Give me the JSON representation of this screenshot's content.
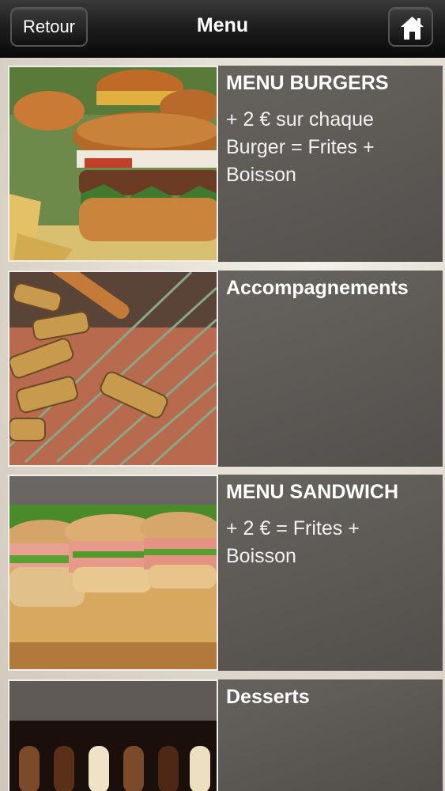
{
  "header": {
    "back_label": "Retour",
    "title": "Menu"
  },
  "items": [
    {
      "title": "MENU BURGERS",
      "description": "+ 2 € sur chaque Burger = Frites + Boisson",
      "image": "burger-photo"
    },
    {
      "title": "Accompagnements",
      "description": "",
      "image": "fries-photo"
    },
    {
      "title": "MENU SANDWICH",
      "description": "+ 2 € = Frites + Boisson",
      "image": "sandwich-photo"
    },
    {
      "title": "Desserts",
      "description": "",
      "image": "ice-cream-photo"
    }
  ],
  "colors": {
    "header_bg": "#111111",
    "panel_bg": "#5c5854",
    "text": "#ffffff"
  },
  "icons": [
    "home-icon"
  ]
}
